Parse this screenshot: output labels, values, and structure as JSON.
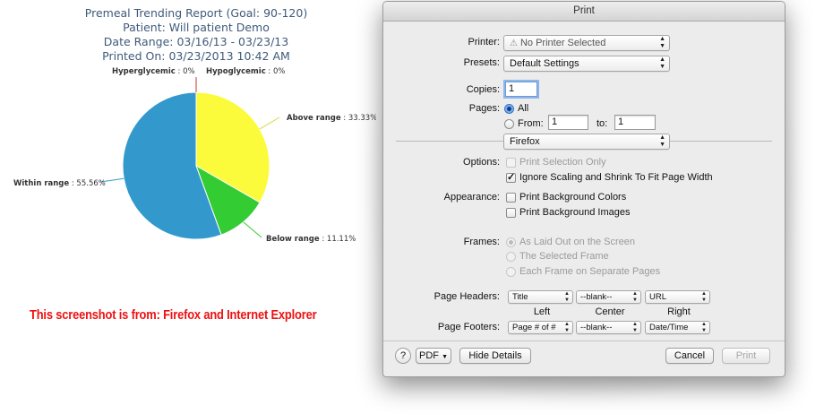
{
  "report": {
    "title": "Premeal Trending Report (Goal: 90-120)",
    "patient": "Patient:  Will patient Demo",
    "date_range": "Date Range: 03/16/13 - 03/23/13",
    "printed_on": "Printed On: 03/23/2013 10:42 AM",
    "caption": "This screenshot is from: Firefox and Internet Explorer"
  },
  "chart_data": {
    "type": "pie",
    "slices": [
      {
        "name": "Hyperglycemic",
        "label": "Hyperglycemic",
        "pct_text": "0%",
        "value": 0,
        "color": "#e04a4a"
      },
      {
        "name": "Hypoglycemic",
        "label": "Hypoglycemic",
        "pct_text": "0%",
        "value": 0,
        "color": "#ff9900"
      },
      {
        "name": "Above range",
        "label": "Above range",
        "pct_text": "33.33%",
        "value": 33.33,
        "color": "#fbfb3c"
      },
      {
        "name": "Below range",
        "label": "Below range",
        "pct_text": "11.11%",
        "value": 11.11,
        "color": "#33cc33"
      },
      {
        "name": "Within range",
        "label": "Within range",
        "pct_text": "55.56%",
        "value": 55.56,
        "color": "#3399cc"
      }
    ]
  },
  "dialog": {
    "title": "Print",
    "printer_label": "Printer:",
    "printer_value": "No Printer Selected",
    "presets_label": "Presets:",
    "presets_value": "Default Settings",
    "copies_label": "Copies:",
    "copies_value": "1",
    "pages_label": "Pages:",
    "pages_all": "All",
    "pages_from": "From:",
    "pages_from_value": "1",
    "pages_to": "to:",
    "pages_to_value": "1",
    "section_value": "Firefox",
    "options_label": "Options:",
    "opt_selection": "Print Selection Only",
    "opt_shrink": "Ignore Scaling and Shrink To Fit Page Width",
    "appearance_label": "Appearance:",
    "app_bg_colors": "Print Background Colors",
    "app_bg_images": "Print Background Images",
    "frames_label": "Frames:",
    "frame_laid_out": "As Laid Out on the Screen",
    "frame_selected": "The Selected Frame",
    "frame_separate": "Each Frame on Separate Pages",
    "headers_label": "Page Headers:",
    "header_left": "Title",
    "header_center": "--blank--",
    "header_right": "URL",
    "col_left": "Left",
    "col_center": "Center",
    "col_right": "Right",
    "footers_label": "Page Footers:",
    "footer_left": "Page # of #",
    "footer_center": "--blank--",
    "footer_right": "Date/Time",
    "help": "?",
    "pdf": "PDF",
    "hide_details": "Hide Details",
    "cancel": "Cancel",
    "print": "Print"
  }
}
